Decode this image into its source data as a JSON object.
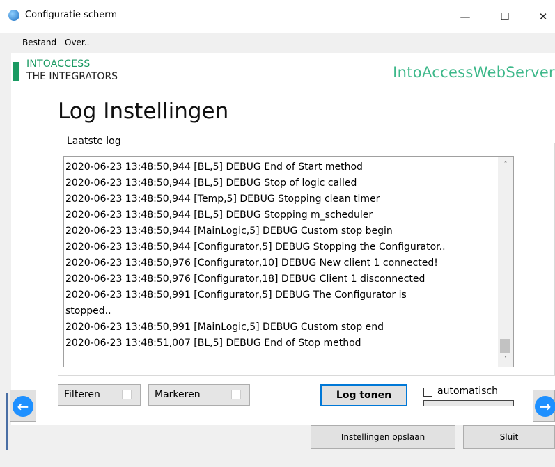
{
  "window": {
    "title": "Configuratie scherm",
    "controls": {
      "minimize": "—",
      "maximize": "☐",
      "close": "✕"
    }
  },
  "menu": [
    "Bestand",
    "Over.."
  ],
  "brand": {
    "line1": "INTOACCESS",
    "line2": "THE INTEGRATORS",
    "server": "IntoAccessWebServer",
    "accent_color": "#1a9a62"
  },
  "page_title": "Log Instellingen",
  "log": {
    "group_label": "Laatste log",
    "lines": [
      "2020-06-23 13:48:50,944 [BL,5] DEBUG End of Start method",
      "2020-06-23 13:48:50,944 [BL,5] DEBUG Stop of logic called",
      "2020-06-23 13:48:50,944 [Temp,5] DEBUG Stopping clean timer",
      "2020-06-23 13:48:50,944 [BL,5] DEBUG Stopping m_scheduler",
      "2020-06-23 13:48:50,944 [MainLogic,5] DEBUG Custom stop begin",
      "2020-06-23 13:48:50,944 [Configurator,5] DEBUG Stopping the Configurator..",
      "2020-06-23 13:48:50,976 [Configurator,10] DEBUG New client 1 connected!",
      "2020-06-23 13:48:50,976 [Configurator,18] DEBUG Client 1 disconnected",
      "2020-06-23 13:48:50,991 [Configurator,5] DEBUG The Configurator is",
      "stopped..",
      "2020-06-23 13:48:50,991 [MainLogic,5] DEBUG Custom stop end",
      "2020-06-23 13:48:51,007 [BL,5] DEBUG End of Stop method"
    ]
  },
  "controls": {
    "filter_label": "Filteren",
    "mark_label": "Markeren",
    "show_log_label": "Log tonen",
    "auto_label": "automatisch"
  },
  "footer": {
    "save_label": "Instellingen opslaan",
    "close_label": "Sluit"
  },
  "icons": {
    "prev": "arrow-left-icon",
    "next": "arrow-right-icon",
    "prev_glyph": "←",
    "next_glyph": "→",
    "scroll_up": "˄",
    "scroll_down": "˅"
  }
}
